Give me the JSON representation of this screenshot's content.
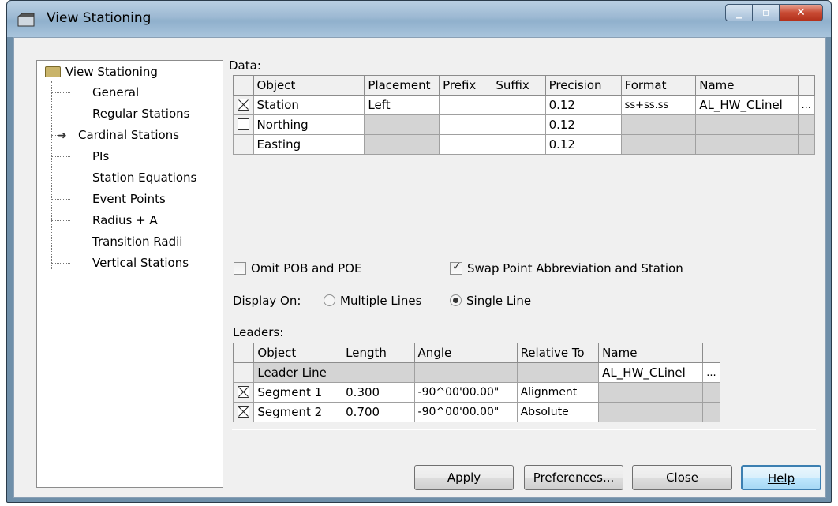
{
  "window": {
    "title": "View Stationing"
  },
  "tree": {
    "root": "View Stationing",
    "items": [
      "General",
      "Regular Stations",
      "Cardinal Stations",
      "PIs",
      "Station Equations",
      "Event Points",
      "Radius + A",
      "Transition Radii",
      "Vertical Stations"
    ],
    "selected": "Cardinal Stations"
  },
  "data_section": {
    "label": "Data:",
    "columns": [
      "Object",
      "Placement",
      "Prefix",
      "Suffix",
      "Precision",
      "Format",
      "Name"
    ],
    "rows": [
      {
        "checked": true,
        "object": "Station",
        "placement": "Left",
        "prefix": "",
        "suffix": "",
        "precision": "0.12",
        "format": "ss+ss.ss",
        "name": "AL_HW_CLinel",
        "more": "..."
      },
      {
        "checked": false,
        "object": "Northing",
        "placement": "",
        "prefix": "",
        "suffix": "",
        "precision": "0.12",
        "format": "",
        "name": ""
      },
      {
        "checked": null,
        "object": "Easting",
        "placement": "",
        "prefix": "",
        "suffix": "",
        "precision": "0.12",
        "format": "",
        "name": ""
      }
    ]
  },
  "options": {
    "omit_pob_poe": {
      "label": "Omit POB and POE",
      "checked": false
    },
    "swap_abbrev": {
      "label": "Swap Point Abbreviation and Station",
      "checked": true
    }
  },
  "display_on": {
    "label": "Display On:",
    "multiple": "Multiple Lines",
    "single": "Single Line",
    "selected": "Single Line"
  },
  "leaders": {
    "label": "Leaders:",
    "columns": [
      "Object",
      "Length",
      "Angle",
      "Relative To",
      "Name"
    ],
    "rows": [
      {
        "checked": null,
        "object": "Leader Line",
        "length": "",
        "angle": "",
        "relative": "",
        "name": "AL_HW_CLinel",
        "more": "..."
      },
      {
        "checked": true,
        "object": "Segment 1",
        "length": "0.300",
        "angle": "-90^00'00.00\"",
        "relative": "Alignment",
        "name": ""
      },
      {
        "checked": true,
        "object": "Segment 2",
        "length": "0.700",
        "angle": "-90^00'00.00\"",
        "relative": "Absolute",
        "name": ""
      }
    ]
  },
  "buttons": {
    "apply": "Apply",
    "preferences": "Preferences...",
    "close": "Close",
    "help": "Help"
  }
}
